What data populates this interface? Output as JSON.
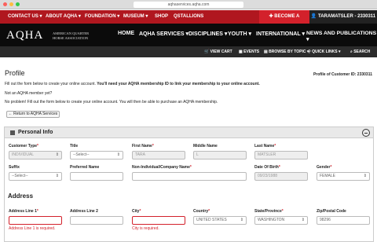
{
  "browser": {
    "url": "aqhaservices.aqha.com"
  },
  "topnav": {
    "items": [
      "CONTACT US ▾",
      "ABOUT AQHA ▾",
      "FOUNDATION ▾",
      "MUSEUM ▾",
      "SHOP",
      "QSTALLIONS"
    ],
    "become_member": "BECOME A MEMBER",
    "user": "TARAMATSLER - 2330311"
  },
  "mainnav": {
    "logo": "AQHA",
    "logo_sub": "AMERICAN QUARTER HORSE ASSOCIATION",
    "items": [
      "HOME",
      "AQHA SERVICES ▾",
      "DISCIPLINES ▾",
      "YOUTH ▾",
      "INTERNATIONAL ▾",
      "NEWS AND PUBLICATIONS ▾"
    ]
  },
  "util": {
    "view_cart": "VIEW CART",
    "events": "EVENTS",
    "browse": "BROWSE BY TOPIC ▾",
    "quick_links": "QUICK LINKS ▾",
    "search": "SEARCH"
  },
  "page": {
    "title": "Profile",
    "profile_id": "Profile of Customer ID: 2330311",
    "instr1a": "Fill out the form below to create your online account. ",
    "instr1b": "You'll need your AQHA membership ID to link your membership to your online account.",
    "instr2": "Not an AQHA member yet?",
    "instr3": "No problem! Fill out the form below to create your online account. You will then be able to purchase an AQHA membership.",
    "return_button": "← Return to AQHA Services"
  },
  "personal": {
    "heading": "Personal Info",
    "labels": {
      "customer_type": "Customer Type",
      "title": "Title",
      "first_name": "First Name",
      "middle_name": "Middle Name",
      "last_name": "Last Name",
      "suffix": "Suffix",
      "preferred_name": "Preferred Name",
      "company": "Non-Individual/Company Name",
      "dob": "Date Of Birth",
      "gender": "Gender"
    },
    "values": {
      "customer_type": "INDIVIDUAL",
      "title": "--Select--",
      "first_name": "TARA",
      "middle_name": "L",
      "last_name": "MATSLER",
      "suffix": "--Select--",
      "preferred_name": "",
      "company": "",
      "dob": "09/23/1988",
      "gender": "FEMALE"
    }
  },
  "address": {
    "heading": "Address",
    "labels": {
      "line1": "Address Line 1",
      "line2": "Address Line 2",
      "city": "City",
      "country": "Country",
      "state": "State/Province",
      "zip": "Zip/Postal Code"
    },
    "values": {
      "line1": "",
      "line2": "",
      "city": "",
      "country": "UNITED STATES",
      "state": "WASHINGTON",
      "zip": "98296"
    },
    "errors": {
      "line1": "Address Line 1 is required.",
      "city": "City is required."
    }
  },
  "required_mark": "*"
}
